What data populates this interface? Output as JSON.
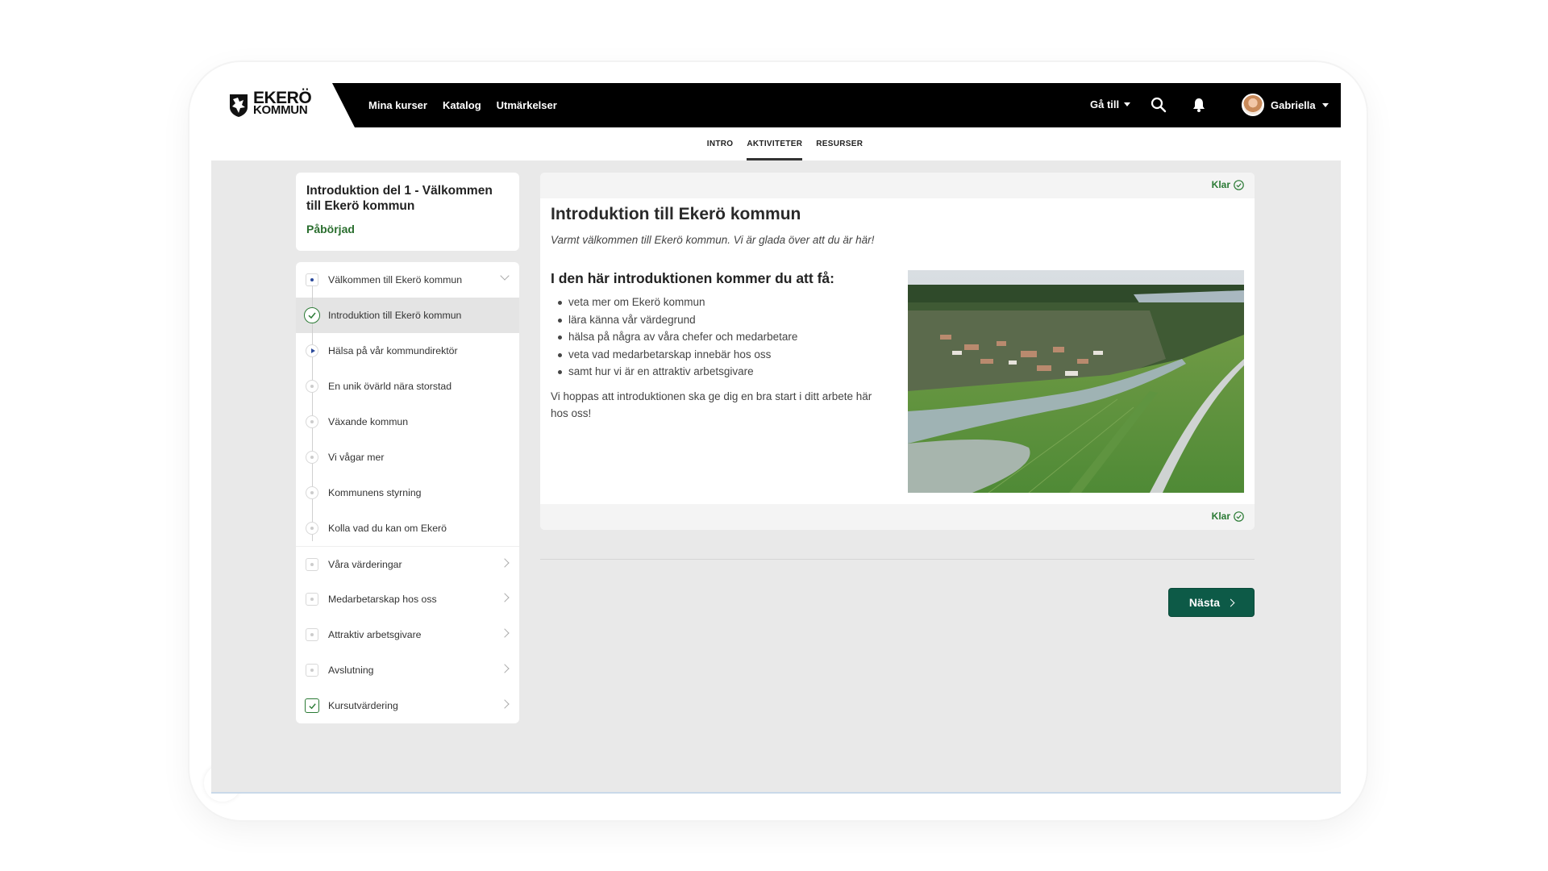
{
  "brand": {
    "line1": "EKERÖ",
    "line2": "KOMMUN"
  },
  "nav": {
    "links": [
      "Mina kurser",
      "Katalog",
      "Utmärkelser"
    ],
    "goto": "Gå till",
    "user": "Gabriella"
  },
  "subnav": {
    "tabs": [
      "INTRO",
      "AKTIVITETER",
      "RESURSER"
    ],
    "active": "AKTIVITETER"
  },
  "course": {
    "title": "Introduktion del 1 - Välkommen till Ekerö kommun",
    "status": "Påbörjad",
    "status_color": "#2a6e2e"
  },
  "lessons": [
    {
      "label": "Välkommen till Ekerö kommun",
      "state": "open"
    },
    {
      "label": "Introduktion till Ekerö kommun",
      "state": "completed"
    },
    {
      "label": "Hälsa på vår kommundirektör",
      "state": "video"
    },
    {
      "label": "En unik övärld nära storstad",
      "state": "not-started"
    },
    {
      "label": "Växande kommun",
      "state": "not-started"
    },
    {
      "label": "Vi vågar mer",
      "state": "not-started"
    },
    {
      "label": "Kommunens styrning",
      "state": "not-started"
    },
    {
      "label": "Kolla vad du kan om Ekerö",
      "state": "not-started"
    },
    {
      "label": "Våra värderingar",
      "state": "section"
    },
    {
      "label": "Medarbetarskap hos oss",
      "state": "section"
    },
    {
      "label": "Attraktiv arbetsgivare",
      "state": "section"
    },
    {
      "label": "Avslutning",
      "state": "section"
    },
    {
      "label": "Kursutvärdering",
      "state": "section-done"
    }
  ],
  "content": {
    "klar_label": "Klar",
    "title": "Introduktion till Ekerö kommun",
    "subtitle": "Varmt välkommen till Ekerö kommun. Vi är glada över att du är här!",
    "section_heading": "I den här introduktionen kommer du att få:",
    "bullets": [
      "veta mer om Ekerö kommun",
      "lära känna vår värdegrund",
      "hälsa på några av våra chefer och medarbetare",
      "veta vad medarbetarskap innebär hos oss",
      "samt hur vi är en attraktiv arbetsgivare"
    ],
    "paragraph": "Vi hoppas att introduktionen ska ge dig en bra start i ditt arbete här hos oss!",
    "image": "aerial-photo-ekero"
  },
  "next_button": {
    "label": "Nästa"
  },
  "colors": {
    "accent_green": "#0d5a47",
    "done_green": "#2a7a34",
    "navbar": "#000000"
  }
}
